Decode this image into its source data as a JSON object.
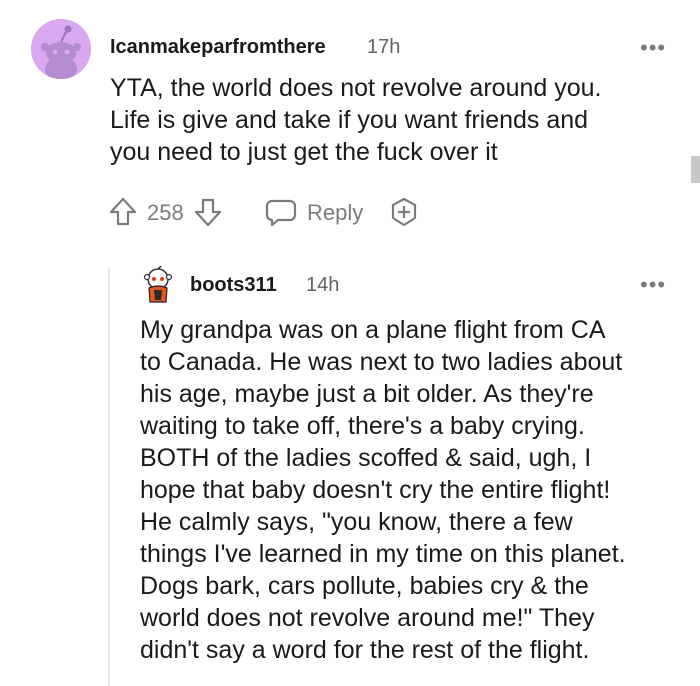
{
  "comment": {
    "username": "Icanmakeparfromthere",
    "time": "17h",
    "more": "•••",
    "body_lines": [
      "YTA, the world does not revolve around you.",
      "Life is give and take if you want friends and",
      "you need to just get the fuck over it"
    ],
    "votes": "258",
    "reply_label": "Reply"
  },
  "reply": {
    "username": "boots311",
    "time": "14h",
    "more": "•••",
    "body_lines": [
      "My grandpa was on a plane flight from CA",
      "to Canada. He was next to two ladies about",
      "his age, maybe just a bit older. As they're",
      "waiting to take off, there's a baby crying.",
      "BOTH of the ladies scoffed & said, ugh, I",
      "hope that baby doesn't cry the entire flight!",
      "He calmly says, \"you know, there a few",
      "things I've learned in my time on this planet.",
      "Dogs bark, cars pollute, babies cry & the",
      "world does not revolve around me!\" They",
      "didn't say a word for the rest of the flight."
    ]
  },
  "colors": {
    "avatar_bg": "#d9a8f0",
    "text": "#1a1a1b",
    "muted": "#787c7e"
  }
}
